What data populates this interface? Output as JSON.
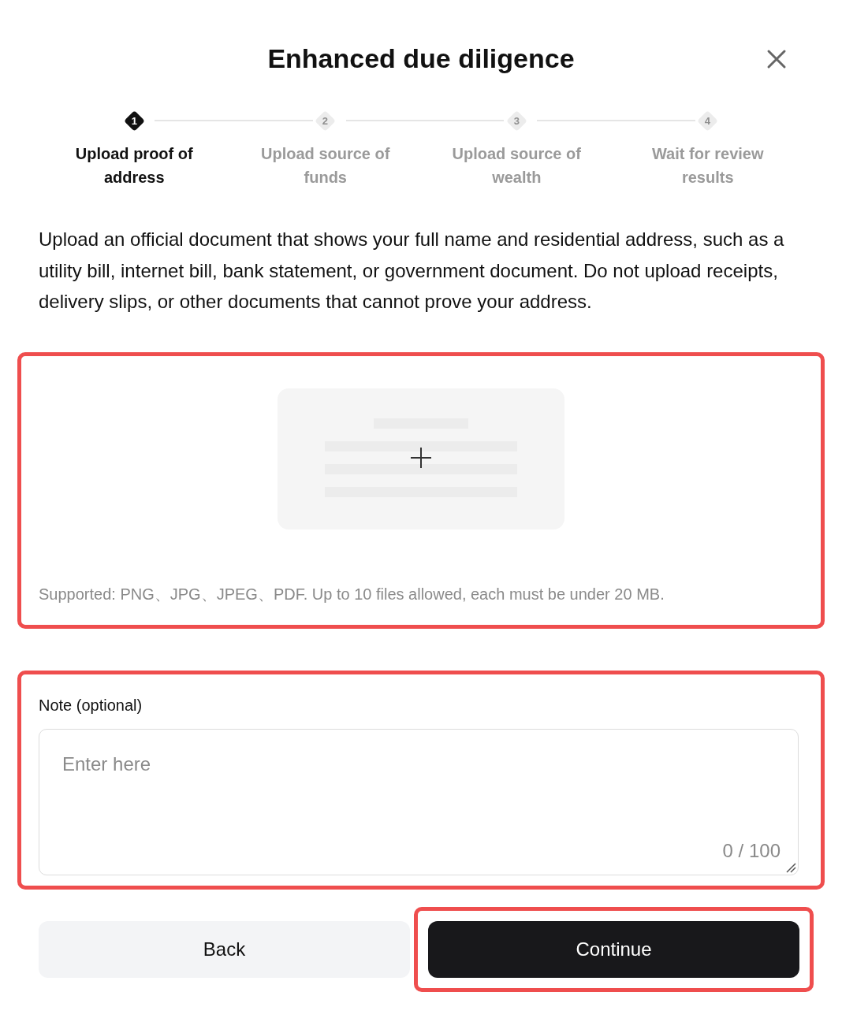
{
  "dialog": {
    "title": "Enhanced due diligence"
  },
  "steps": [
    {
      "number": "1",
      "label": "Upload proof of address",
      "selected": true
    },
    {
      "number": "2",
      "label": "Upload source of funds",
      "selected": false
    },
    {
      "number": "3",
      "label": "Upload source of wealth",
      "selected": false
    },
    {
      "number": "4",
      "label": "Wait for review results",
      "selected": false
    }
  ],
  "instructions": "Upload an official document that shows your full name and residential address, such as a utility bill, internet bill, bank statement, or government document. Do not upload receipts, delivery slips, or other documents that cannot prove your address.",
  "upload": {
    "hint": "Supported: PNG、JPG、JPEG、PDF. Up to 10 files allowed, each must be under 20 MB."
  },
  "note": {
    "label": "Note (optional)",
    "placeholder": "Enter here",
    "counter": "0 / 100"
  },
  "buttons": [
    {
      "kind": "secondary",
      "label": "Back"
    },
    {
      "kind": "primary",
      "label": "Continue"
    }
  ]
}
